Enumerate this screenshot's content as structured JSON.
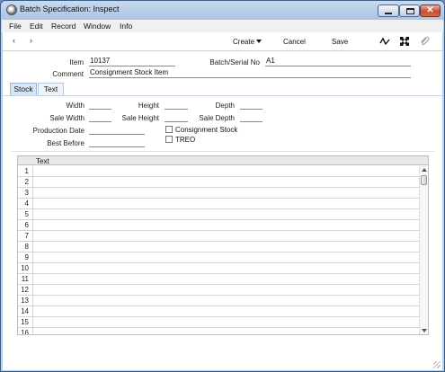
{
  "window": {
    "title": "Batch Specification: Inspect",
    "buttons": {
      "minimize": "minimize",
      "maximize": "maximize",
      "close": "✕"
    }
  },
  "menu": {
    "items": [
      "File",
      "Edit",
      "Record",
      "Window",
      "Info"
    ]
  },
  "toolbar": {
    "nav_back": "‹",
    "nav_forward": "›",
    "create_label": "Create",
    "cancel_label": "Cancel",
    "save_label": "Save",
    "icons": [
      "signal-icon",
      "resize-arrows-icon",
      "attachment-icon"
    ]
  },
  "form": {
    "item_label": "Item",
    "item_value": "10137",
    "batch_serial_label": "Batch/Serial No",
    "batch_serial_value": "A1",
    "comment_label": "Comment",
    "comment_value": "Consignment Stock Item"
  },
  "tabs": [
    "Stock",
    "Text"
  ],
  "stock": {
    "width_label": "Width",
    "height_label": "Height",
    "depth_label": "Depth",
    "sale_width_label": "Sale Width",
    "sale_height_label": "Sale Height",
    "sale_depth_label": "Sale Depth",
    "production_date_label": "Production Date",
    "best_before_label": "Best Before",
    "consignment_stock_label": "Consignment Stock",
    "treo_label": "TREO",
    "consignment_stock_checked": false,
    "treo_checked": false
  },
  "matrix": {
    "column_header": "Text",
    "rows": [
      "1",
      "2",
      "3",
      "4",
      "5",
      "6",
      "7",
      "8",
      "9",
      "10",
      "11",
      "12",
      "13",
      "14",
      "15",
      "16"
    ]
  },
  "colors": {
    "window_border": "#3d5f86",
    "titlebar": "#a9c4e4",
    "tab_active": "#d7e6f6",
    "close_button": "#c44e30"
  }
}
